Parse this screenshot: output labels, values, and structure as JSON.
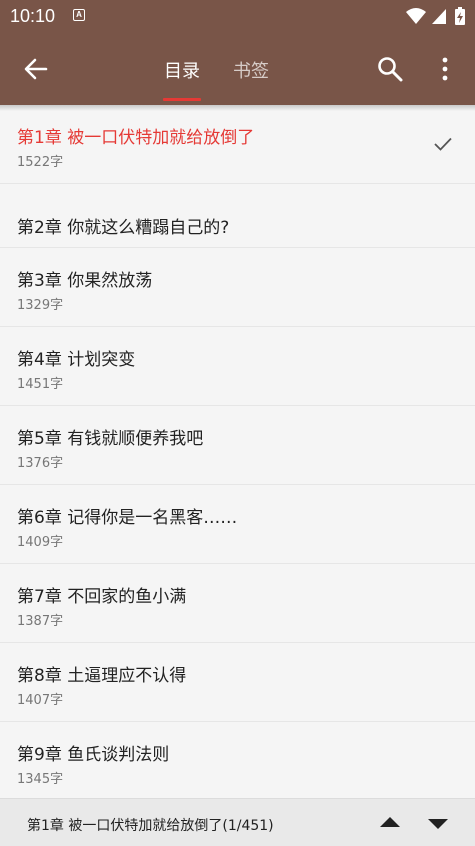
{
  "status_bar": {
    "time": "10:10",
    "notification_icon": "A"
  },
  "header": {
    "tabs": [
      {
        "label": "目录",
        "active": true
      },
      {
        "label": "书签",
        "active": false
      }
    ],
    "accent_color": "#795548",
    "indicator_color": "#e53935"
  },
  "chapters": [
    {
      "title": "第1章 被一口伏特加就给放倒了",
      "count": "1522字",
      "current": true
    },
    {
      "title": "第2章 你就这么糟蹋自己的?",
      "count": "",
      "current": false
    },
    {
      "title": "第3章 你果然放荡",
      "count": "1329字",
      "current": false
    },
    {
      "title": "第4章 计划突变",
      "count": "1451字",
      "current": false
    },
    {
      "title": "第5章 有钱就顺便养我吧",
      "count": "1376字",
      "current": false
    },
    {
      "title": "第6章 记得你是一名黑客……",
      "count": "1409字",
      "current": false
    },
    {
      "title": "第7章 不回家的鱼小满",
      "count": "1387字",
      "current": false
    },
    {
      "title": "第8章 土逼理应不认得",
      "count": "1407字",
      "current": false
    },
    {
      "title": "第9章 鱼氏谈判法则",
      "count": "1345字",
      "current": false
    }
  ],
  "bottom_bar": {
    "current_chapter": "第1章 被一口伏特加就给放倒了(1/451)"
  }
}
